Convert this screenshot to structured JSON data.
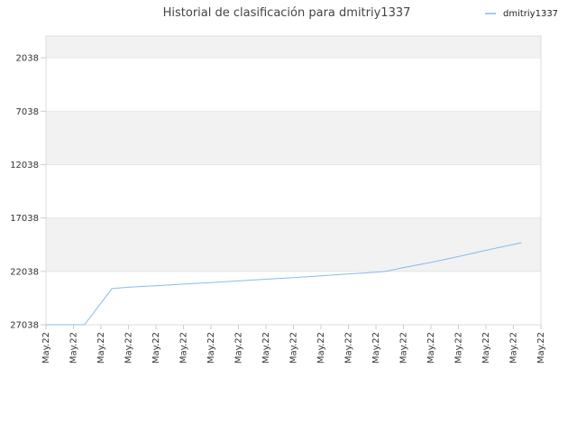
{
  "chart_data": {
    "type": "line",
    "title": "Historial de clasificación para dmitriy1337",
    "xlabel": "",
    "ylabel": "",
    "y_inverted": true,
    "ylim": [
      27038,
      0
    ],
    "yticks": [
      2038,
      7038,
      12038,
      17038,
      22038,
      27038
    ],
    "x_tick_labels": [
      "May.22",
      "May.22",
      "May.22",
      "May.22",
      "May.22",
      "May.22",
      "May.22",
      "May.22",
      "May.22",
      "May.22",
      "May.22",
      "May.22",
      "May.22",
      "May.22",
      "May.22",
      "May.22",
      "May.22",
      "May.22",
      "May.22"
    ],
    "legend": {
      "position": "top-right"
    },
    "grid": true,
    "series": [
      {
        "name": "dmitriy1337",
        "color": "#88bbee",
        "points": [
          [
            0,
            27038
          ],
          [
            1.4,
            27038
          ],
          [
            2.4,
            23650
          ],
          [
            3,
            23520
          ],
          [
            4,
            23380
          ],
          [
            5,
            23230
          ],
          [
            6,
            23090
          ],
          [
            7,
            22930
          ],
          [
            8,
            22770
          ],
          [
            9,
            22620
          ],
          [
            10,
            22450
          ],
          [
            11,
            22280
          ],
          [
            12,
            22120
          ],
          [
            12.4,
            22020
          ],
          [
            13,
            21680
          ],
          [
            14,
            21200
          ],
          [
            15,
            20650
          ],
          [
            16,
            20070
          ],
          [
            17.3,
            19350
          ]
        ]
      }
    ]
  },
  "colors": {
    "band": "#f2f2f2",
    "plot_border": "#dddddd",
    "grid": "#e6e6e6"
  }
}
